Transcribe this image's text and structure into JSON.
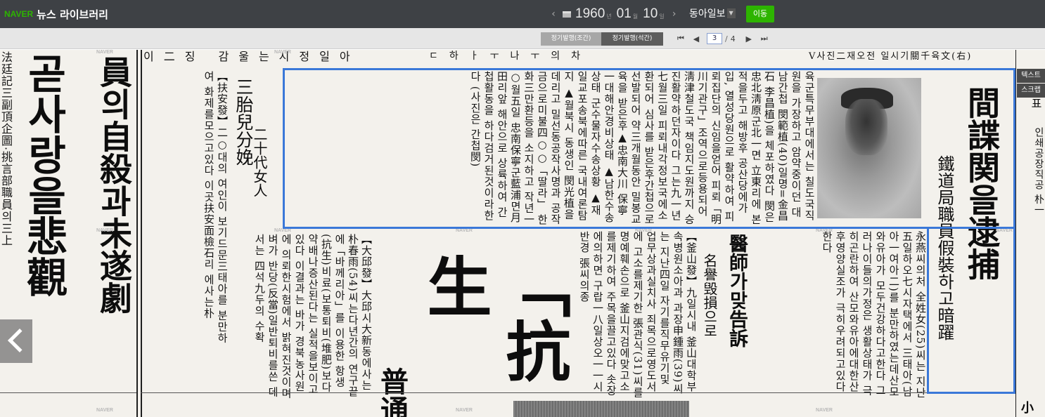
{
  "app": {
    "logo_brand": "NAVER",
    "logo_title": "뉴스 라이브러리",
    "brand_color": "#2db400"
  },
  "date_nav": {
    "prev_icon": "chevron-left",
    "next_icon": "chevron-right",
    "year": "1960",
    "year_unit": "년",
    "month": "01",
    "month_unit": "월",
    "day": "10",
    "day_unit": "일",
    "newspaper": "동아일보",
    "go_label": "이동"
  },
  "view_tabs": [
    {
      "label": "정기발행(조간)"
    },
    {
      "label": "정기발행(석간)"
    }
  ],
  "pager": {
    "current": "3",
    "separator": "/",
    "total": "4"
  },
  "side_buttons": [
    {
      "label": "텍스트"
    },
    {
      "label": "스크랩"
    }
  ],
  "watermark": "NAVER",
  "newspaper_page": {
    "left_headline_1": "員의自殺과未遂劇",
    "left_headline_2": "곧사랑을悲觀",
    "left_col_text": "法廷記三副頂企圖·挑言部職員의三上",
    "sub_head_a": "三胎兒分娩",
    "sub_head_b": "二十代女人",
    "sub_body_a": "【扶安發】二○대의 여인이 보기드문三태아를 분만하여 화제를모으고있다 이곳扶安面檢石리 에사는朴",
    "main_headline": "間諜関을逮捕",
    "main_subhead": "鐵道局職員假裝하고暗躍",
    "main_body": "육군특무부대에서는 칠도국직원을 가장하고 암약중이던 대남간첩 閔範植(40)일명=金昌石 李昌植)을 체포하였다 閔은 忠北淸原군北一면 立東리에 본적을두고 해방후 공산당에가입, 열성당원으로 활약하여 피뢰집단의 신임을얻어 피뢰「明川기관구」조역으로등용되어 淸津철도국 책임지도원까지 승진활약하던자이다 그는九一년七월三일 피뢰내각정보국에소환되어 심사를 받은후간첩으로 선발되어 약三개월동안 밀봉교육을 받은후▲忠南大川 保寧一대해안경비상태 ▲남한수송상태 군수물자수송상황 ▲재일교포송북에따른 국내여론탐지 ▲월북시 동생인 閔光植을데리고 밀선동공작사명과 공작금으로미불四○○「딸라」 한화三만환등을 소지하고 작년一○월五일 忠南保寧군藍浦면月田리앞 해안으로 상륙하여 간첩활동을 하다검거된것이라한다 (사진은 간첩閔)",
    "right_col_text": "永燕씨의처 全姓女(25)씨는 지난五일하오七시자택에서 三태아(남아一여아二)를 분만하였는데산모와유아가 모두건강하다고한다 그러나이들의가정은 생활상태가 극히곤란하여 산모와유아에대한산후영양실조가 극히우려되고있다한다",
    "med_head_a": "醫師가맞告訴",
    "med_head_b": "名譽毁損으로",
    "med_body": "【釜山發】九일시내 釜山대학부속병원소아과 과장申鍾雨(39)씨는 지난四일 자기를직무유기및 업무상과실치사 죄목으로영도서에 고소를제기한 張관식(31)씨를 명예훼손으로 釜山지검에맞고소를제기하여 주목을끌고있다 솟장에의하면 구랍一八일상오一一시반경 張씨의종",
    "daegu_body": "【大邱發】大邱시大新동에사는 朴春雨(54)씨는다년간의 연구끝에「바께리아」를 이용한 항생(抗生)비료(보통퇴비(堆肥)보다 약배나증산된다는 실적을보이고있다 이결과는 바가 경북농사원에 의뢰한시험에서 밝혀진것이며 벼가 반당(反當)일반퇴비를쓴 데서는 四석九두의 수확",
    "big_head": "「抗生",
    "big_head_small": "普通",
    "top_strip_left": "이二징 감울는시정일아",
    "top_strip_mid": "ㄷ하ㅏㅜ나ㅜ의차",
    "top_strip_right": "V사진二재오전 일시기關千육文(右)",
    "far_right_a": "표",
    "far_right_b": "인쇄공장직공 朴一",
    "bottom_right": "小"
  }
}
